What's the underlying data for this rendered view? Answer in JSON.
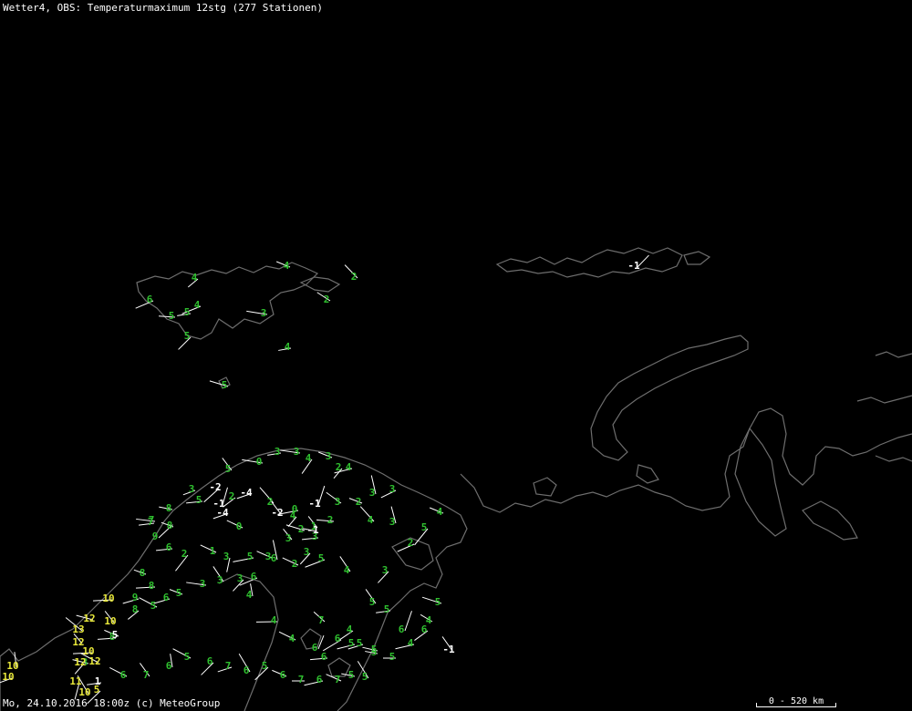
{
  "header": {
    "title": "Wetter4, OBS: Temperaturmaximum 12stg (277 Stationen)"
  },
  "footer": {
    "timestamp": "Mo, 24.10.2016 18:00z (c) MeteoGroup"
  },
  "scale": {
    "label": "0 - 520 km"
  },
  "colors": {
    "background": "#000000",
    "coastline": "#6e6e6e",
    "cold": "#ffffff",
    "mild": "#2fbf2f",
    "warm": "#e8e83a",
    "wind_barb": "#ffffff"
  },
  "legend_note": "",
  "stations": [
    {
      "v": "4",
      "c": "mild"
    },
    {
      "v": "6",
      "c": "mild"
    },
    {
      "v": "5",
      "c": "mild"
    },
    {
      "v": "5",
      "c": "mild"
    },
    {
      "v": "4",
      "c": "mild"
    },
    {
      "v": "5",
      "c": "mild"
    },
    {
      "v": "4",
      "c": "mild"
    },
    {
      "v": "3",
      "c": "mild"
    },
    {
      "v": "2",
      "c": "mild"
    },
    {
      "v": "2",
      "c": "mild"
    },
    {
      "v": "4",
      "c": "mild"
    },
    {
      "v": "5",
      "c": "mild"
    },
    {
      "v": "-1",
      "c": "cold"
    },
    {
      "v": "3",
      "c": "mild"
    },
    {
      "v": "3",
      "c": "mild"
    },
    {
      "v": "4",
      "c": "mild"
    },
    {
      "v": "3",
      "c": "mild"
    },
    {
      "v": "0",
      "c": "mild"
    },
    {
      "v": "4",
      "c": "mild"
    },
    {
      "v": "5",
      "c": "mild"
    },
    {
      "v": "2",
      "c": "mild"
    },
    {
      "v": "3",
      "c": "mild"
    },
    {
      "v": "3",
      "c": "mild"
    },
    {
      "v": "2",
      "c": "mild"
    },
    {
      "v": "4",
      "c": "mild"
    },
    {
      "v": "3",
      "c": "mild"
    },
    {
      "v": "4",
      "c": "mild"
    },
    {
      "v": "5",
      "c": "mild"
    },
    {
      "v": "2",
      "c": "mild"
    },
    {
      "v": "-2",
      "c": "cold"
    },
    {
      "v": "4",
      "c": "mild"
    },
    {
      "v": "2",
      "c": "mild"
    },
    {
      "v": "3",
      "c": "mild"
    },
    {
      "v": "-4",
      "c": "cold"
    },
    {
      "v": "-1",
      "c": "cold"
    },
    {
      "v": "2",
      "c": "mild"
    },
    {
      "v": "1",
      "c": "mild"
    },
    {
      "v": "0",
      "c": "mild"
    },
    {
      "v": "-1",
      "c": "cold"
    },
    {
      "v": "2",
      "c": "mild"
    },
    {
      "v": "3",
      "c": "mild"
    },
    {
      "v": "7",
      "c": "mild"
    },
    {
      "v": "5",
      "c": "mild"
    },
    {
      "v": "-4",
      "c": "cold"
    },
    {
      "v": "-2",
      "c": "cold"
    },
    {
      "v": "0",
      "c": "mild"
    },
    {
      "v": "-1",
      "c": "cold"
    },
    {
      "v": "2",
      "c": "mild"
    },
    {
      "v": "3",
      "c": "mild"
    },
    {
      "v": "7",
      "c": "mild"
    },
    {
      "v": "8",
      "c": "mild"
    },
    {
      "v": "9",
      "c": "mild"
    },
    {
      "v": "6",
      "c": "mild"
    },
    {
      "v": "8",
      "c": "mild"
    },
    {
      "v": "2",
      "c": "mild"
    },
    {
      "v": "1",
      "c": "mild"
    },
    {
      "v": "3",
      "c": "mild"
    },
    {
      "v": "5",
      "c": "mild"
    },
    {
      "v": "3",
      "c": "mild"
    },
    {
      "v": "3",
      "c": "mild"
    },
    {
      "v": "4",
      "c": "mild"
    },
    {
      "v": "6",
      "c": "mild"
    },
    {
      "v": "3",
      "c": "mild"
    },
    {
      "v": "3",
      "c": "mild"
    },
    {
      "v": "6",
      "c": "mild"
    },
    {
      "v": "2",
      "c": "mild"
    },
    {
      "v": "3",
      "c": "mild"
    },
    {
      "v": "5",
      "c": "mild"
    },
    {
      "v": "4",
      "c": "mild"
    },
    {
      "v": "3",
      "c": "mild"
    },
    {
      "v": "8",
      "c": "mild"
    },
    {
      "v": "8",
      "c": "mild"
    },
    {
      "v": "6",
      "c": "mild"
    },
    {
      "v": "5",
      "c": "mild"
    },
    {
      "v": "3",
      "c": "mild"
    },
    {
      "v": "5",
      "c": "mild"
    },
    {
      "v": "5",
      "c": "mild"
    },
    {
      "v": "6",
      "c": "mild"
    },
    {
      "v": "4",
      "c": "mild"
    },
    {
      "v": "5",
      "c": "mild"
    },
    {
      "v": "5",
      "c": "mild"
    },
    {
      "v": "10",
      "c": "warm"
    },
    {
      "v": "9",
      "c": "mild"
    },
    {
      "v": "8",
      "c": "mild"
    },
    {
      "v": "5",
      "c": "mild"
    },
    {
      "v": "12",
      "c": "warm"
    },
    {
      "v": "10",
      "c": "warm"
    },
    {
      "v": "13",
      "c": "warm"
    },
    {
      "v": "8",
      "c": "mild"
    },
    {
      "v": "5",
      "c": "cold"
    },
    {
      "v": "12",
      "c": "warm"
    },
    {
      "v": "10",
      "c": "warm"
    },
    {
      "v": "3",
      "c": "mild"
    },
    {
      "v": "12",
      "c": "warm"
    },
    {
      "v": "12",
      "c": "warm"
    },
    {
      "v": "11",
      "c": "warm"
    },
    {
      "v": "1",
      "c": "cold"
    },
    {
      "v": "10",
      "c": "warm"
    },
    {
      "v": "5",
      "c": "warm"
    },
    {
      "v": "10",
      "c": "warm"
    },
    {
      "v": "10",
      "c": "warm"
    },
    {
      "v": "6",
      "c": "mild"
    },
    {
      "v": "7",
      "c": "mild"
    },
    {
      "v": "6",
      "c": "mild"
    },
    {
      "v": "5",
      "c": "mild"
    },
    {
      "v": "6",
      "c": "mild"
    },
    {
      "v": "7",
      "c": "mild"
    },
    {
      "v": "6",
      "c": "mild"
    },
    {
      "v": "5",
      "c": "mild"
    },
    {
      "v": "6",
      "c": "mild"
    },
    {
      "v": "7",
      "c": "mild"
    },
    {
      "v": "6",
      "c": "mild"
    },
    {
      "v": "7",
      "c": "mild"
    },
    {
      "v": "5",
      "c": "mild"
    },
    {
      "v": "5",
      "c": "mild"
    },
    {
      "v": "6",
      "c": "mild"
    },
    {
      "v": "6",
      "c": "mild"
    },
    {
      "v": "6",
      "c": "mild"
    },
    {
      "v": "5",
      "c": "mild"
    },
    {
      "v": "5",
      "c": "mild"
    },
    {
      "v": "5",
      "c": "mild"
    },
    {
      "v": "4",
      "c": "mild"
    },
    {
      "v": "6",
      "c": "mild"
    },
    {
      "v": "4",
      "c": "mild"
    },
    {
      "v": "5",
      "c": "mild"
    },
    {
      "v": "-1",
      "c": "cold"
    },
    {
      "v": "7",
      "c": "mild"
    },
    {
      "v": "4",
      "c": "mild"
    },
    {
      "v": "4",
      "c": "mild"
    }
  ]
}
